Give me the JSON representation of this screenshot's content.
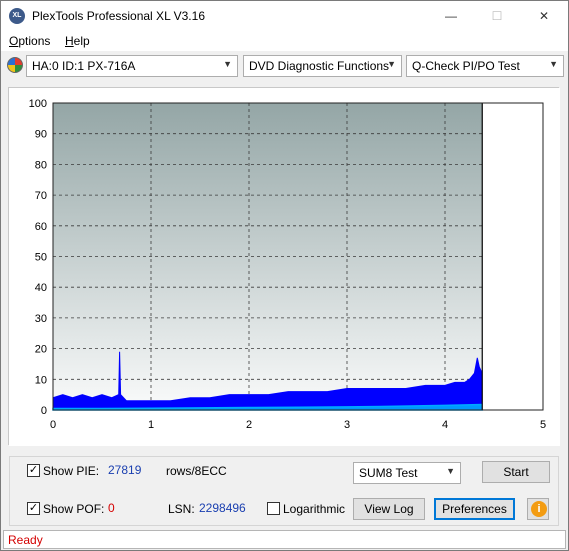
{
  "window": {
    "title": "PlexTools Professional XL V3.16",
    "icon_label": "XL",
    "buttons": {
      "minimize": "—",
      "maximize": "☐",
      "close": "✕"
    }
  },
  "menu": {
    "options": "Options",
    "options_key": "O",
    "options_rest": "ptions",
    "help": "Help",
    "help_key": "H",
    "help_rest": "elp"
  },
  "toolbar": {
    "drive": "HA:0 ID:1  PX-716A",
    "function": "DVD Diagnostic Functions",
    "test": "Q-Check PI/PO Test"
  },
  "chart_data": {
    "type": "area",
    "y_ticks": [
      "100",
      "90",
      "80",
      "70",
      "60",
      "50",
      "40",
      "30",
      "20",
      "10",
      "0"
    ],
    "x_ticks": [
      "0",
      "1",
      "2",
      "3",
      "4",
      "5"
    ],
    "ylim": [
      0,
      100
    ],
    "xlim": [
      0,
      5
    ],
    "end_marker_x": 4.38,
    "grid": true,
    "series": [
      {
        "color": "#0000ff",
        "x": [
          0.0,
          0.1,
          0.2,
          0.3,
          0.4,
          0.5,
          0.6,
          0.67,
          0.68,
          0.69,
          0.75,
          0.8,
          0.9,
          1.0,
          1.2,
          1.4,
          1.6,
          1.8,
          2.0,
          2.2,
          2.4,
          2.6,
          2.8,
          3.0,
          3.2,
          3.4,
          3.6,
          3.8,
          4.0,
          4.1,
          4.2,
          4.25,
          4.3,
          4.33,
          4.35,
          4.38
        ],
        "values": [
          4,
          5,
          4,
          5,
          4,
          5,
          4,
          5,
          19,
          5,
          3,
          3,
          3,
          3,
          3,
          4,
          4,
          5,
          5,
          5,
          6,
          6,
          6,
          7,
          7,
          7,
          7,
          8,
          8,
          9,
          9,
          10,
          12,
          17,
          14,
          12
        ]
      },
      {
        "color": "#00aaff",
        "x": [
          0.0,
          0.5,
          1.0,
          1.5,
          2.0,
          2.5,
          3.0,
          3.5,
          4.0,
          4.38
        ],
        "values": [
          0.5,
          0.5,
          0.6,
          0.7,
          0.8,
          0.9,
          1.0,
          1.2,
          1.5,
          1.8
        ]
      }
    ]
  },
  "controls": {
    "show_pie_label": "Show PIE:",
    "show_pie_checked": "✓",
    "pie_value": "27819",
    "pie_unit": "rows/8ECC",
    "show_poe_label": "Show POF:",
    "show_poe_checked": "✓",
    "poe_value": "0",
    "lsn_label": "LSN:",
    "lsn_value": "2298496",
    "logarithmic_label": "Logarithmic",
    "sum_select": "SUM8 Test",
    "start_button": "Start",
    "view_log_button": "View Log",
    "preferences_button": "Preferences",
    "info_icon": "i"
  },
  "status": {
    "text": "Ready"
  }
}
